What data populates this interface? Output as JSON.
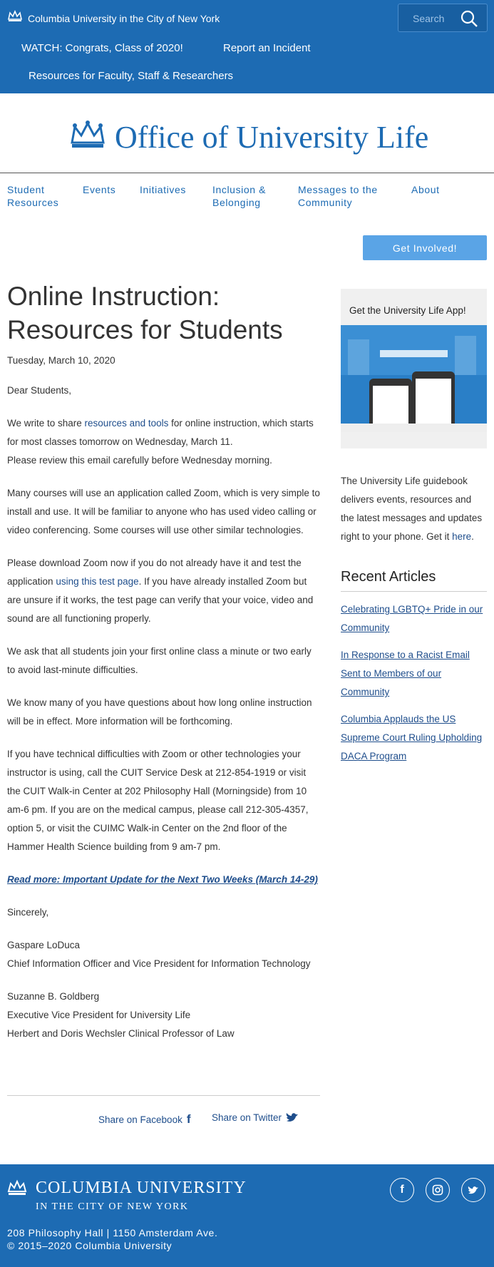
{
  "topbar": {
    "university": "Columbia University in the City of New York",
    "search_placeholder": "Search",
    "links": [
      "WATCH: Congrats, Class of 2020!",
      "Report an Incident",
      "Resources for Faculty, Staff & Researchers"
    ]
  },
  "masthead": {
    "title": "Office of University Life"
  },
  "nav": {
    "items": [
      "Student Resources",
      "Events",
      "Initiatives",
      "Inclusion & Belonging",
      "Messages to the Community",
      "About"
    ]
  },
  "cta": {
    "label": "Get Involved!"
  },
  "article": {
    "title": "Online Instruction: Resources for Students",
    "date": "Tuesday, March 10, 2020",
    "greeting": "Dear Students,",
    "p1_before": "We write to share ",
    "p1_link": "resources and tools",
    "p1_after": " for online instruction, which starts for most classes tomorrow on Wednesday, March 11.",
    "p1_line2": "Please review this email carefully before Wednesday morning.",
    "p2": "Many courses will use an application called Zoom, which is very simple to install and use. It will be familiar to anyone who has used video calling or video conferencing. Some courses will use other similar technologies.",
    "p3_before": "Please download Zoom now if you do not already have it and test the application ",
    "p3_link": "using this test page",
    "p3_after": ". If you have already installed Zoom but are unsure if it works, the test page can verify that your voice, video and sound are all functioning properly.",
    "p4": "We ask that all students join your first online class a minute or two early to avoid last-minute difficulties.",
    "p5": "We know many of you have questions about how long online instruction will be in effect. More information will be forthcoming.",
    "p6": "If you have technical difficulties with Zoom or other technologies your instructor is using, call the CUIT Service Desk at 212-854-1919 or visit the CUIT Walk-in Center at 202 Philosophy Hall (Morningside) from 10 am-6 pm. If you are on the medical campus, please call 212-305-4357, option 5, or visit the CUIMC Walk-in Center on the 2nd floor of the Hammer Health Science building from 9 am-7 pm.",
    "read_more": "Read more: Important Update for the Next Two Weeks (March 14-29)",
    "closing": "Sincerely,",
    "sig1_name": "Gaspare LoDuca",
    "sig1_title": "Chief Information Officer and Vice President for Information Technology",
    "sig2_name": "Suzanne B. Goldberg",
    "sig2_title1": "Executive Vice President for University Life",
    "sig2_title2": "Herbert and Doris Wechsler Clinical Professor of Law"
  },
  "share": {
    "facebook": "Share on Facebook",
    "twitter": "Share on Twitter"
  },
  "sidebar": {
    "app_title": "Get the University Life App!",
    "app_text_before": "The University Life guidebook delivers events, resources and the latest messages and updates right to your phone. Get it ",
    "app_link": "here",
    "app_text_after": ".",
    "recent_heading": "Recent Articles",
    "recent": [
      "Celebrating LGBTQ+ Pride in our Community",
      "In Response to a Racist Email Sent to Members of our Community",
      "Columbia Applauds the US Supreme Court Ruling Upholding DACA Program"
    ]
  },
  "footer": {
    "name": "COLUMBIA UNIVERSITY",
    "sub": "IN THE CITY OF NEW YORK",
    "address": "208 Philosophy Hall | 1150 Amsterdam Ave.",
    "copyright": "© 2015–2020 Columbia University",
    "social_icons": [
      "facebook-icon",
      "instagram-icon",
      "twitter-icon"
    ]
  },
  "colors": {
    "brand_blue": "#1d6bb3",
    "link_blue": "#1f4e8c",
    "cta_blue": "#5aa4e6"
  }
}
